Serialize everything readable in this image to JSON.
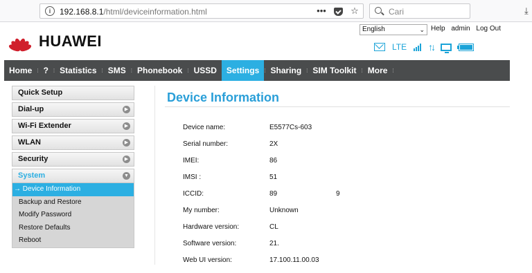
{
  "browser": {
    "url_host": "192.168.8.1",
    "url_path": "/html/deviceinformation.html",
    "more_label": "•••",
    "bookmark_star": "☆",
    "search_placeholder": "Cari",
    "download_glyph": "⤓"
  },
  "header": {
    "brand": "HUAWEI",
    "language": "English",
    "help_label": "Help",
    "user_label": "admin",
    "logout_label": "Log Out",
    "network_type": "LTE",
    "accent_color": "#2cafe2",
    "icons": [
      "mail-icon",
      "signal-icon",
      "data-transfer-icon",
      "pc-connection-icon",
      "battery-icon"
    ]
  },
  "nav": {
    "items": [
      {
        "label": "Home"
      },
      {
        "label": "?"
      },
      {
        "label": "Statistics"
      },
      {
        "label": "SMS"
      },
      {
        "label": "Phonebook"
      },
      {
        "label": "USSD"
      },
      {
        "label": "Settings"
      },
      {
        "label": "Sharing"
      },
      {
        "label": "SIM Toolkit"
      },
      {
        "label": "More"
      }
    ],
    "active": "Settings"
  },
  "sidebar": {
    "items": [
      {
        "label": "Quick Setup"
      },
      {
        "label": "Dial-up"
      },
      {
        "label": "Wi-Fi Extender"
      },
      {
        "label": "WLAN"
      },
      {
        "label": "Security"
      },
      {
        "label": "System"
      }
    ],
    "system_subitems": [
      {
        "label": "Device Information"
      },
      {
        "label": "Backup and Restore"
      },
      {
        "label": "Modify Password"
      },
      {
        "label": "Restore Defaults"
      },
      {
        "label": "Reboot"
      }
    ],
    "active_marker": "→"
  },
  "main": {
    "title": "Device Information",
    "rows": [
      {
        "label": "Device name:",
        "value": "E5577Cs-603",
        "extra": ""
      },
      {
        "label": "Serial number:",
        "value": "2X",
        "extra": ""
      },
      {
        "label": "IMEI:",
        "value": "86",
        "extra": ""
      },
      {
        "label": "IMSI :",
        "value": "51",
        "extra": ""
      },
      {
        "label": "ICCID:",
        "value": "89",
        "extra": "9"
      },
      {
        "label": "My number:",
        "value": "Unknown",
        "extra": ""
      },
      {
        "label": "Hardware version:",
        "value": "CL",
        "extra": ""
      },
      {
        "label": "Software version:",
        "value": "21.",
        "extra": ""
      },
      {
        "label": "Web UI version:",
        "value": "17.100.11.00.03",
        "extra": ""
      }
    ]
  }
}
